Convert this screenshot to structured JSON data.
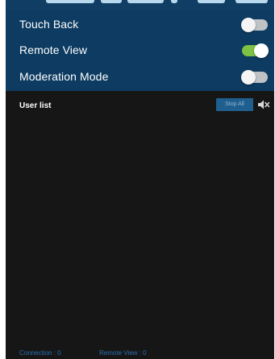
{
  "settings": {
    "items": [
      {
        "label": "Touch Back",
        "enabled": false
      },
      {
        "label": "Remote View",
        "enabled": true
      },
      {
        "label": "Moderation Mode",
        "enabled": false
      }
    ]
  },
  "user_list": {
    "title": "User list",
    "stop_all_label": "Stop All",
    "speaker_icon": "speaker-muted-icon",
    "users": []
  },
  "status": {
    "connection": "Connection : 0",
    "remote_view": "Remote View : 0"
  },
  "colors": {
    "settings_bg": "#0d3b61",
    "panel_bg": "#161616",
    "toggle_on": "#7ec243",
    "toggle_off": "#bfc3c6",
    "stop_all_bg": "#1f5f8f",
    "status_text": "#2b6fb4"
  }
}
